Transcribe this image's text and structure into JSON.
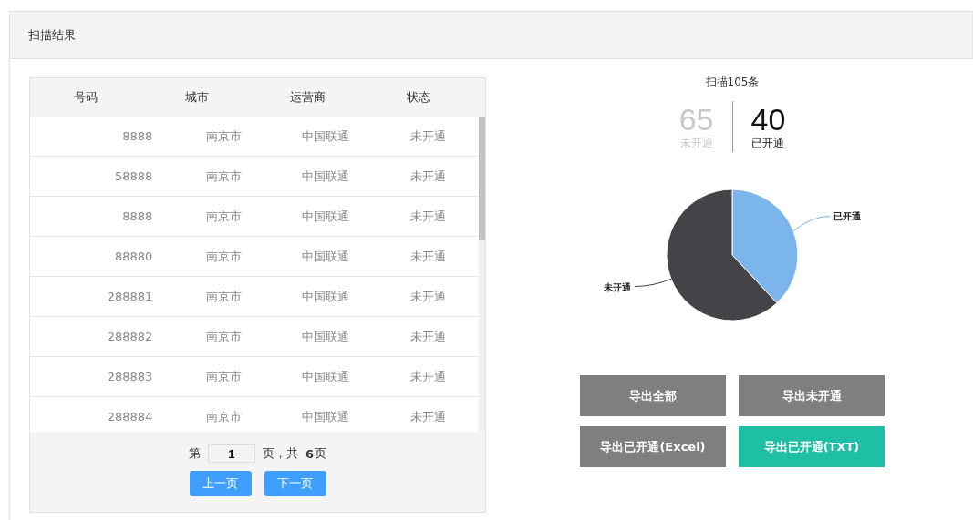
{
  "panel": {
    "title": "扫描结果"
  },
  "table": {
    "columns": [
      "号码",
      "城市",
      "运营商",
      "状态"
    ],
    "rows": [
      {
        "number": "8888",
        "city": "南京市",
        "carrier": "中国联通",
        "status": "未开通"
      },
      {
        "number": "58888",
        "city": "南京市",
        "carrier": "中国联通",
        "status": "未开通"
      },
      {
        "number": "8888",
        "city": "南京市",
        "carrier": "中国联通",
        "status": "未开通"
      },
      {
        "number": "88880",
        "city": "南京市",
        "carrier": "中国联通",
        "status": "未开通"
      },
      {
        "number": "288881",
        "city": "南京市",
        "carrier": "中国联通",
        "status": "未开通"
      },
      {
        "number": "288882",
        "city": "南京市",
        "carrier": "中国联通",
        "status": "未开通"
      },
      {
        "number": "288883",
        "city": "南京市",
        "carrier": "中国联通",
        "status": "未开通"
      },
      {
        "number": "288884",
        "city": "南京市",
        "carrier": "中国联通",
        "status": "未开通"
      }
    ]
  },
  "pagination": {
    "prefix": "第",
    "page": "1",
    "middle": "页，共",
    "total": "6",
    "suffix": "页",
    "prev": "上一页",
    "next": "下一页"
  },
  "summary": {
    "title": "扫描105条",
    "stats": [
      {
        "value": "65",
        "label": "未开通",
        "kind": "muted"
      },
      {
        "value": "40",
        "label": "已开通",
        "kind": "strong"
      }
    ]
  },
  "chart": {
    "chart_data": {
      "type": "pie",
      "categories": [
        "已开通",
        "未开通"
      ],
      "values": [
        38.1,
        61.9
      ],
      "colors": [
        "#7cb5ec",
        "#434348"
      ]
    }
  },
  "buttons": [
    {
      "label": "导出全部",
      "kind": "grey"
    },
    {
      "label": "导出未开通",
      "kind": "grey"
    },
    {
      "label": "导出已开通(Excel)",
      "kind": "grey"
    },
    {
      "label": "导出已开通(TXT)",
      "kind": "teal"
    }
  ]
}
